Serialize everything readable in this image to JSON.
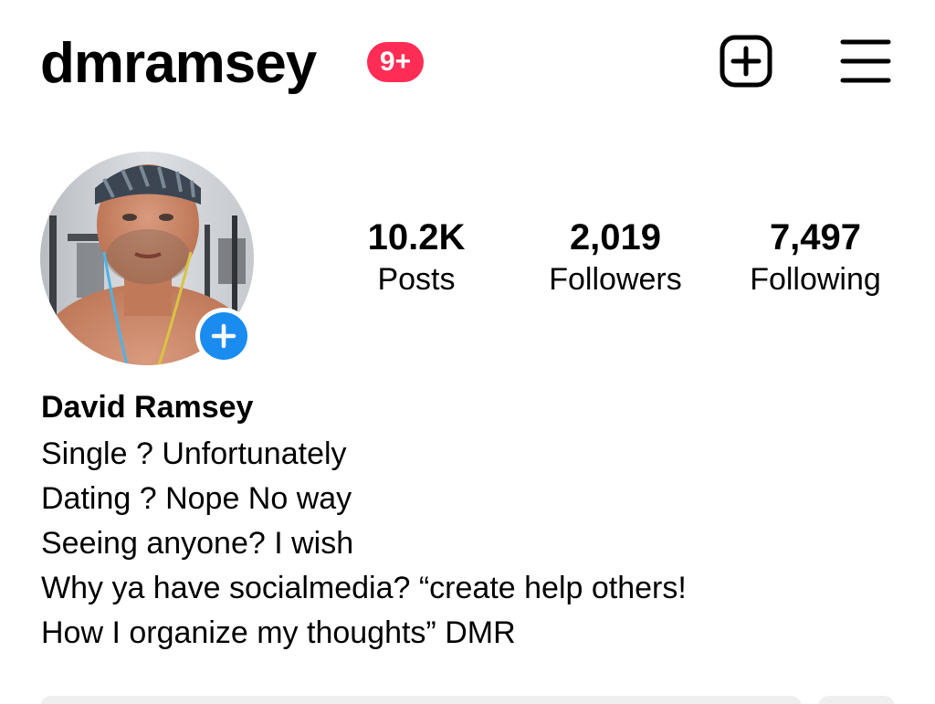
{
  "header": {
    "username": "dmramsey",
    "notification_badge": "9+",
    "badge_color": "#ff2d55",
    "new_post_icon": "plus-square-icon",
    "menu_icon": "hamburger-menu-icon"
  },
  "profile": {
    "avatar_add_icon": "plus-icon",
    "avatar_add_color": "#1a8cf0",
    "stats": {
      "posts": {
        "value": "10.2K",
        "label": "Posts"
      },
      "followers": {
        "value": "2,019",
        "label": "Followers"
      },
      "following": {
        "value": "7,497",
        "label": "Following"
      }
    },
    "display_name": "David Ramsey",
    "bio_lines": [
      "Single ? Unfortunately",
      "Dating ? Nope No way",
      "Seeing anyone? I wish",
      "Why ya have socialmedia? “create help others!",
      "How I organize my thoughts” DMR"
    ]
  }
}
